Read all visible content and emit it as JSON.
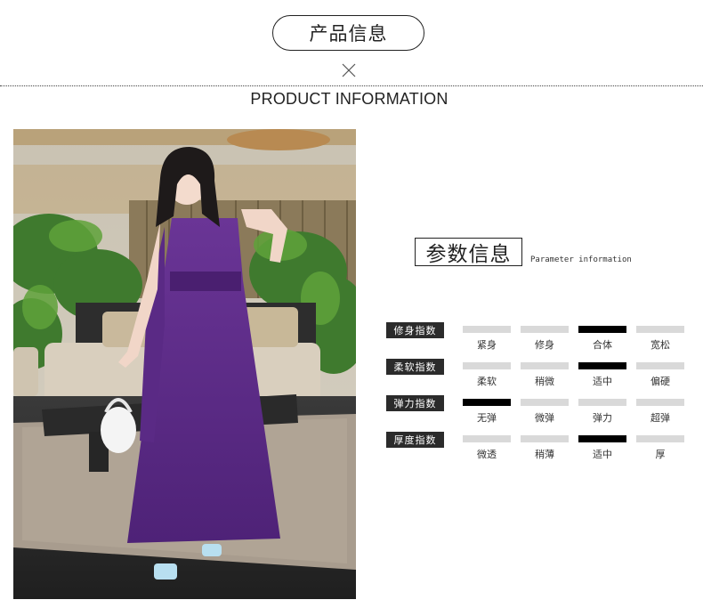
{
  "header": {
    "pill_title": "产品信息",
    "en_title": "PRODUCT INFORMATION"
  },
  "photo": {
    "description_icon": "model-photo"
  },
  "params": {
    "title": "参数信息",
    "subtitle": "Parameter information",
    "rows": [
      {
        "label": "修身指数",
        "options": [
          "紧身",
          "修身",
          "合体",
          "宽松"
        ],
        "selected": 2
      },
      {
        "label": "柔软指数",
        "options": [
          "柔软",
          "稍微",
          "适中",
          "偏硬"
        ],
        "selected": 2
      },
      {
        "label": "弹力指数",
        "options": [
          "无弹",
          "微弹",
          "弹力",
          "超弹"
        ],
        "selected": 0
      },
      {
        "label": "厚度指数",
        "options": [
          "微透",
          "稍薄",
          "适中",
          "厚"
        ],
        "selected": 2
      }
    ]
  },
  "colors": {
    "selected_bar": "#000000",
    "unselected_bar": "#d9d9d9",
    "label_bg": "#2b2b2b",
    "dress": "#5b2a86"
  }
}
